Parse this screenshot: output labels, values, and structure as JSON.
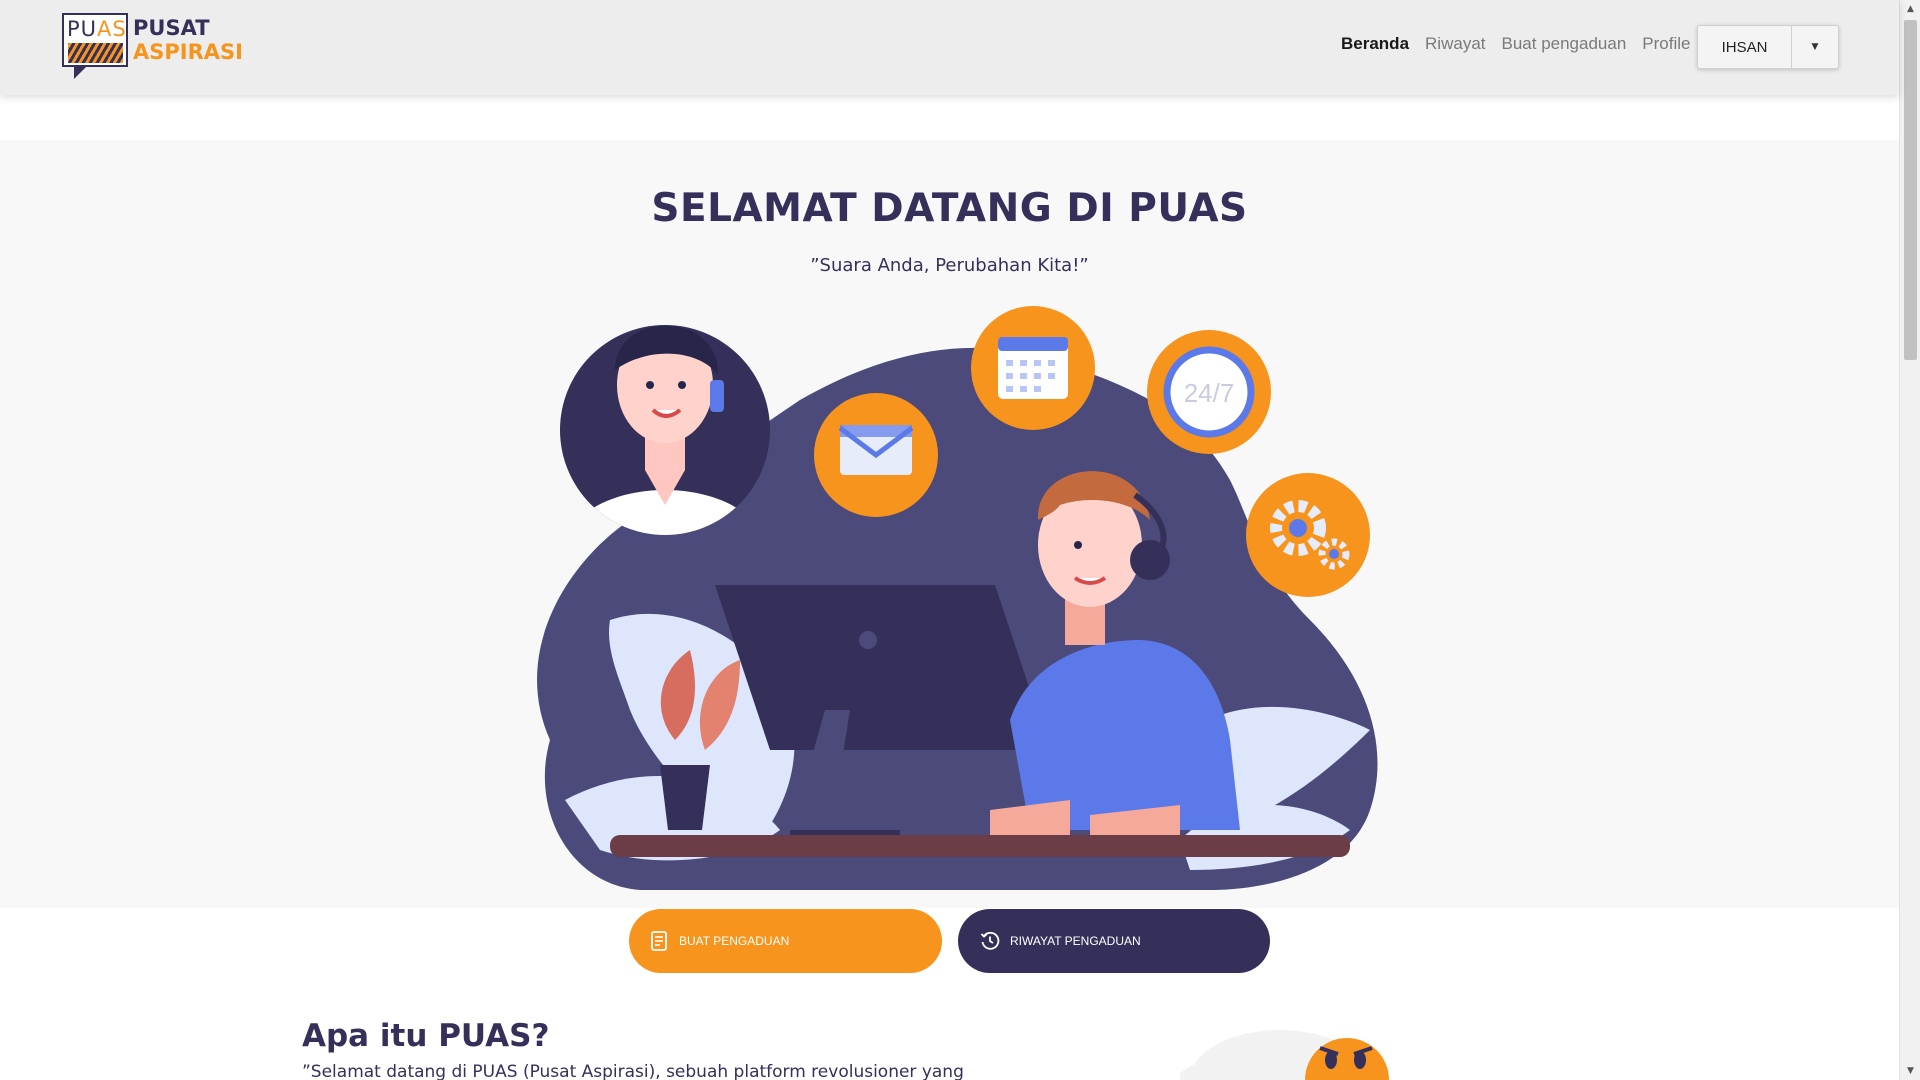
{
  "brand": {
    "logo_box_text_dark": "PU",
    "logo_box_text_accent": "AS",
    "name_line1": "PUSAT",
    "name_line2": "ASPIRASI",
    "primary_color": "#35305a",
    "accent_color": "#f7941d"
  },
  "nav": {
    "items": [
      {
        "label": "Beranda",
        "active": true
      },
      {
        "label": "Riwayat",
        "active": false
      },
      {
        "label": "Buat pengaduan",
        "active": false
      },
      {
        "label": "Profile",
        "active": false
      }
    ],
    "user_button": {
      "label": "IHSAN",
      "caret_icon": "caret-down-icon"
    }
  },
  "hero": {
    "title": "SELAMAT DATANG DI PUAS",
    "subtitle": "”Suara Anda, Perubahan Kita!”",
    "clock_text": "24/7"
  },
  "actions": {
    "create_label": "BUAT PENGADUAN",
    "create_icon": "document-edit-icon",
    "history_label": "RIWAYAT PENGADUAN",
    "history_icon": "history-icon"
  },
  "about": {
    "title": "Apa itu PUAS?",
    "text": "”Selamat datang di PUAS (Pusat Aspirasi), sebuah platform revolusioner yang"
  }
}
